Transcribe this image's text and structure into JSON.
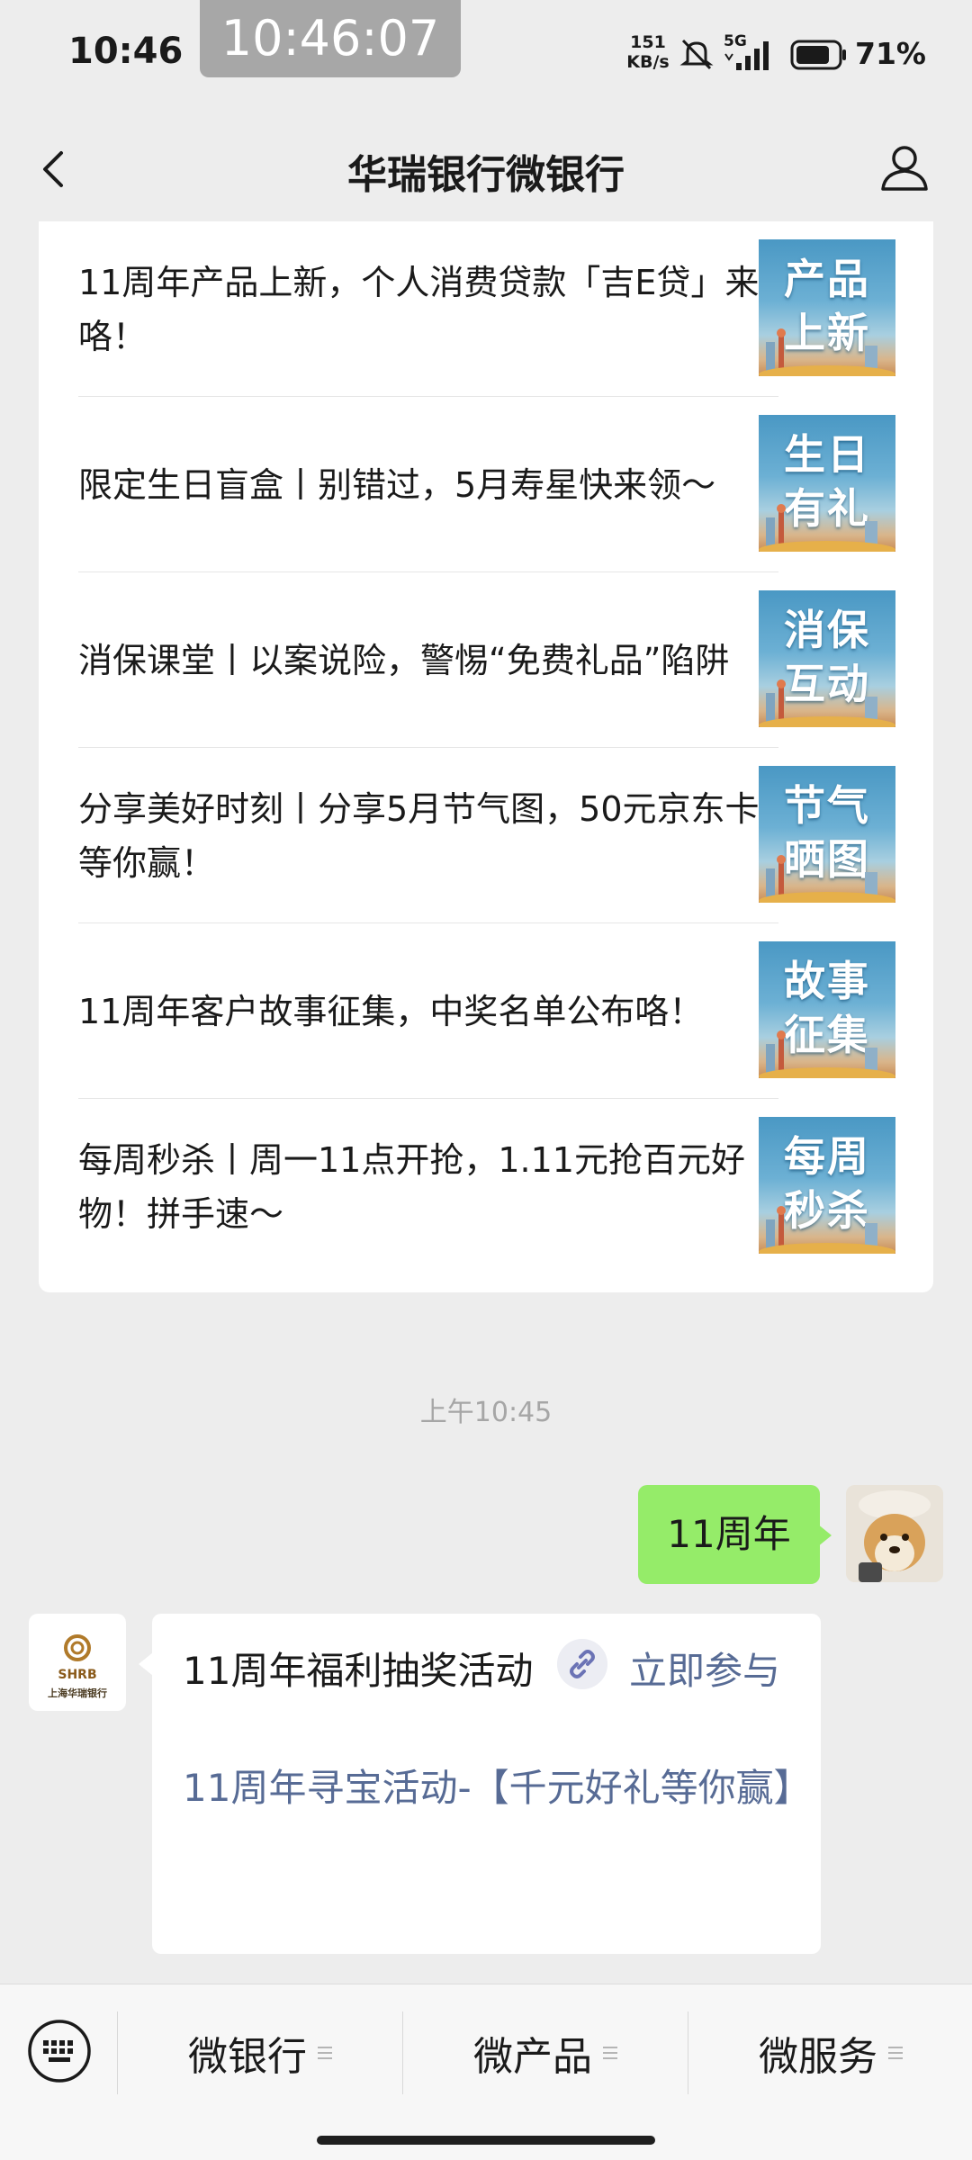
{
  "status_bar": {
    "time": "10:46",
    "recording_clock": "10:46:07",
    "net_speed_value": "151",
    "net_speed_unit": "KB/s",
    "network_type": "5G",
    "battery_percent": "71%"
  },
  "nav": {
    "title": "华瑞银行微银行"
  },
  "articles": [
    {
      "title": "11周年产品上新，个人消费贷款「吉E贷」来咯！",
      "thumb_line1": "产品",
      "thumb_line2": "上新"
    },
    {
      "title": "限定生日盲盒丨别错过，5月寿星快来领～",
      "thumb_line1": "生日",
      "thumb_line2": "有礼"
    },
    {
      "title": "消保课堂丨以案说险，警惕“免费礼品”陷阱",
      "thumb_line1": "消保",
      "thumb_line2": "互动"
    },
    {
      "title": "分享美好时刻丨分享5月节气图，50元京东卡等你赢！",
      "thumb_line1": "节气",
      "thumb_line2": "晒图"
    },
    {
      "title": "11周年客户故事征集，中奖名单公布咯！",
      "thumb_line1": "故事",
      "thumb_line2": "征集"
    },
    {
      "title": "每周秒杀丨周一11点开抢，1.11元抢百元好物！拼手速～",
      "thumb_line1": "每周",
      "thumb_line2": "秒杀"
    }
  ],
  "chat": {
    "timestamp": "上午10:45",
    "user_message": "11周年",
    "bank_logo_text": "SHRB",
    "bank_logo_sub": "上海华瑞银行",
    "reply_line1": "11周年福利抽奖活动",
    "reply_action": "立即参与",
    "reply_line2": "11周年寻宝活动-【千元好礼等你赢】"
  },
  "bottom_menu": {
    "items": [
      "微银行",
      "微产品",
      "微服务"
    ]
  }
}
